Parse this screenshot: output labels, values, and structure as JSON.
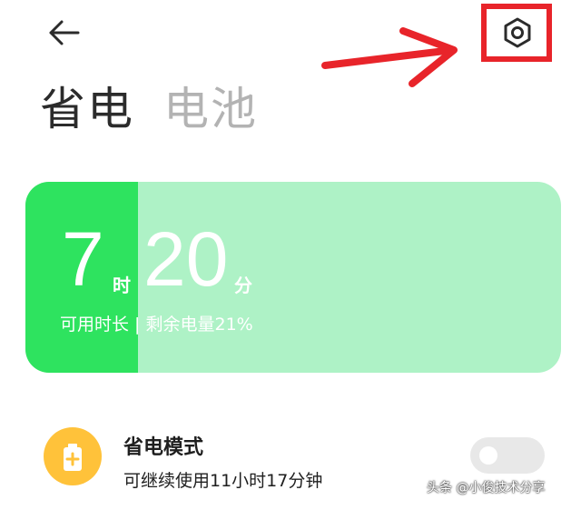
{
  "header": {
    "back_icon": "arrow-left-icon",
    "settings_icon": "hexagon-settings-icon",
    "highlight_color": "#e8242a"
  },
  "tabs": [
    {
      "label": "省电",
      "active": true
    },
    {
      "label": "电池",
      "active": false
    }
  ],
  "battery_card": {
    "hours": "7",
    "hours_unit": "时",
    "minutes": "20",
    "minutes_unit": "分",
    "subtitle": "可用时长 | 剩余电量21%",
    "level_percent": 21,
    "fill_color": "#2ee35f",
    "background_color": "#aef2c6"
  },
  "power_mode": {
    "icon": "battery-plus-icon",
    "icon_color": "#ffc23a",
    "title": "省电模式",
    "subtitle": "可继续使用11小时17分钟",
    "enabled": false
  },
  "watermark": "头条 @小俊技术分享"
}
